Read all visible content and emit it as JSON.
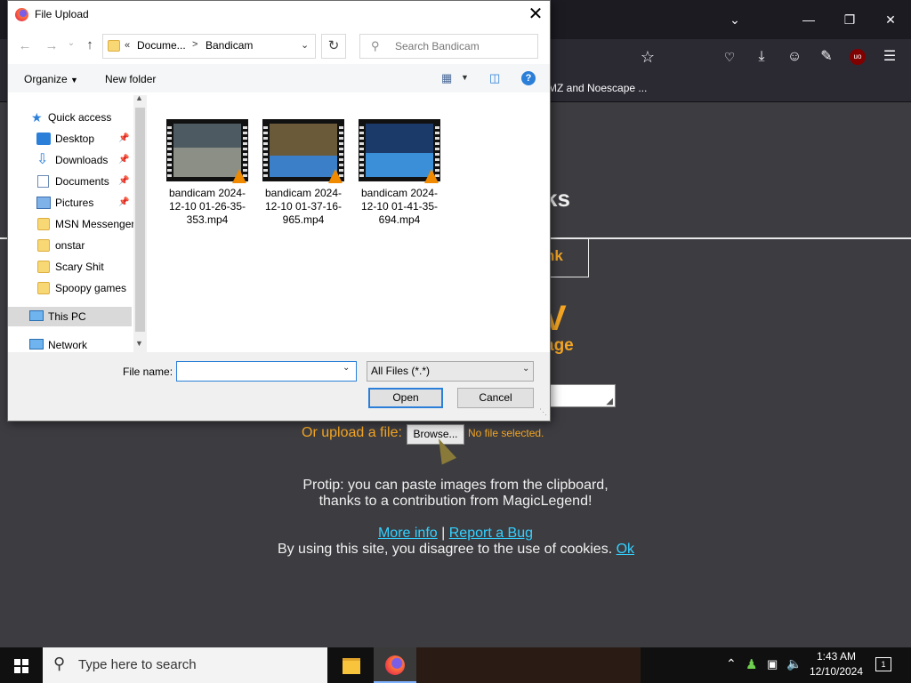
{
  "browser": {
    "bookmark_fragment": "MZ and Noescape ...",
    "page": {
      "heading_fragment": "ks",
      "link_fragment": "nk",
      "big_letter": "V",
      "sub_fragment": "age",
      "upload_label": "Or upload a file:",
      "browse_label": "Browse...",
      "no_file": "No file selected.",
      "protip_line1": "Protip: you can paste images from the clipboard,",
      "protip_line2": "thanks to a contribution from MagicLegend!",
      "more_info": "More info",
      "separator": "|",
      "report_bug": "Report a Bug",
      "cookie_text": "By using this site, you disagree to the use of cookies.",
      "cookie_ok": "Ok"
    }
  },
  "dialog": {
    "title": "File Upload",
    "path": {
      "prefix": "«",
      "segment1": "Docume...",
      "arrow": ">",
      "segment2": "Bandicam"
    },
    "search_placeholder": "Search Bandicam",
    "cmd": {
      "organize": "Organize",
      "new_folder": "New folder"
    },
    "nav": {
      "quick_access": "Quick access",
      "desktop": "Desktop",
      "downloads": "Downloads",
      "documents": "Documents",
      "pictures": "Pictures",
      "msn": "MSN Messenger",
      "onstar": "onstar",
      "scary": "Scary Shit",
      "spoopy": "Spoopy games",
      "this_pc": "This PC",
      "network": "Network"
    },
    "files": [
      {
        "name": "bandicam 2024-12-10 01-26-35-353.mp4"
      },
      {
        "name": "bandicam 2024-12-10 01-37-16-965.mp4"
      },
      {
        "name": "bandicam 2024-12-10 01-41-35-694.mp4"
      }
    ],
    "file_name_label": "File name:",
    "file_name_value": "",
    "filter": "All Files (*.*)",
    "open": "Open",
    "cancel": "Cancel"
  },
  "taskbar": {
    "search_placeholder": "Type here to search",
    "time": "1:43 AM",
    "date": "12/10/2024",
    "notification_count": "1"
  },
  "colors": {
    "accent_orange": "#f5a623",
    "link_cyan": "#34d1ff",
    "dialog_blue": "#2b7fd8"
  }
}
